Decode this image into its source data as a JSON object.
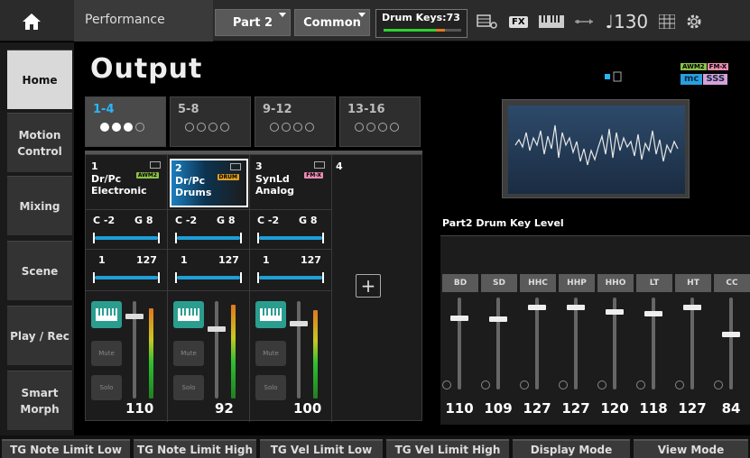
{
  "topbar": {
    "title": "Performance",
    "part_button": "Part 2",
    "common_button": "Common",
    "drum_keys_label": "Drum Keys:73",
    "fx_label": "FX",
    "tempo": "♩130"
  },
  "leftnav": {
    "items": [
      {
        "label": "Home",
        "active": true
      },
      {
        "label": "Motion Control",
        "active": false
      },
      {
        "label": "Mixing",
        "active": false
      },
      {
        "label": "Scene",
        "active": false
      },
      {
        "label": "Play / Rec",
        "active": false
      },
      {
        "label": "Smart Morph",
        "active": false
      }
    ]
  },
  "main": {
    "title": "Output",
    "tabs": [
      {
        "label": "1-4",
        "dots": [
          true,
          true,
          true,
          false
        ],
        "active": true
      },
      {
        "label": "5-8",
        "dots": [
          false,
          false,
          false,
          false
        ],
        "active": false
      },
      {
        "label": "9-12",
        "dots": [
          false,
          false,
          false,
          false
        ],
        "active": false
      },
      {
        "label": "13-16",
        "dots": [
          false,
          false,
          false,
          false
        ],
        "active": false
      }
    ],
    "parts": [
      {
        "num": "1",
        "category": "Dr/Pc",
        "name": "Electronic",
        "tag": "AWM2",
        "tag_color": "#8bc34a",
        "note_low": "C -2",
        "note_high": "G 8",
        "vel_low": "1",
        "vel_high": "127",
        "mute": "Mute",
        "solo": "Solo",
        "volume": "110"
      },
      {
        "num": "2",
        "category": "Dr/Pc",
        "name": "Drums",
        "tag": "DRUM",
        "tag_color": "#e0a020",
        "note_low": "C -2",
        "note_high": "G 8",
        "vel_low": "1",
        "vel_high": "127",
        "mute": "Mute",
        "solo": "Solo",
        "volume": "92"
      },
      {
        "num": "3",
        "category": "SynLd",
        "name": "Analog",
        "tag": "FM-X",
        "tag_color": "#e88ab0",
        "note_low": "C -2",
        "note_high": "G 8",
        "vel_low": "1",
        "vel_high": "127",
        "mute": "Mute",
        "solo": "Solo",
        "volume": "100"
      },
      {
        "num": "4"
      }
    ],
    "engine_badges": {
      "awm2": "AWM2",
      "fmx": "FM-X",
      "mc": "mc",
      "ss": "SSS"
    },
    "drum_key_title": "Part2 Drum Key Level",
    "drum_keys": [
      {
        "label": "BD",
        "value": "110"
      },
      {
        "label": "SD",
        "value": "109"
      },
      {
        "label": "HHC",
        "value": "127"
      },
      {
        "label": "HHP",
        "value": "127"
      },
      {
        "label": "HHO",
        "value": "120"
      },
      {
        "label": "LT",
        "value": "118"
      },
      {
        "label": "HT",
        "value": "127"
      },
      {
        "label": "CC",
        "value": "84"
      }
    ]
  },
  "bottombar": {
    "items": [
      "TG Note Limit Low",
      "TG Note Limit High",
      "TG Vel Limit Low",
      "TG Vel Limit High",
      "Display Mode",
      "View Mode"
    ]
  },
  "colors": {
    "accent_blue": "#1e9fd8",
    "keyboard_button": "#2a9d8f",
    "active_nav": "#d9d9d9"
  }
}
